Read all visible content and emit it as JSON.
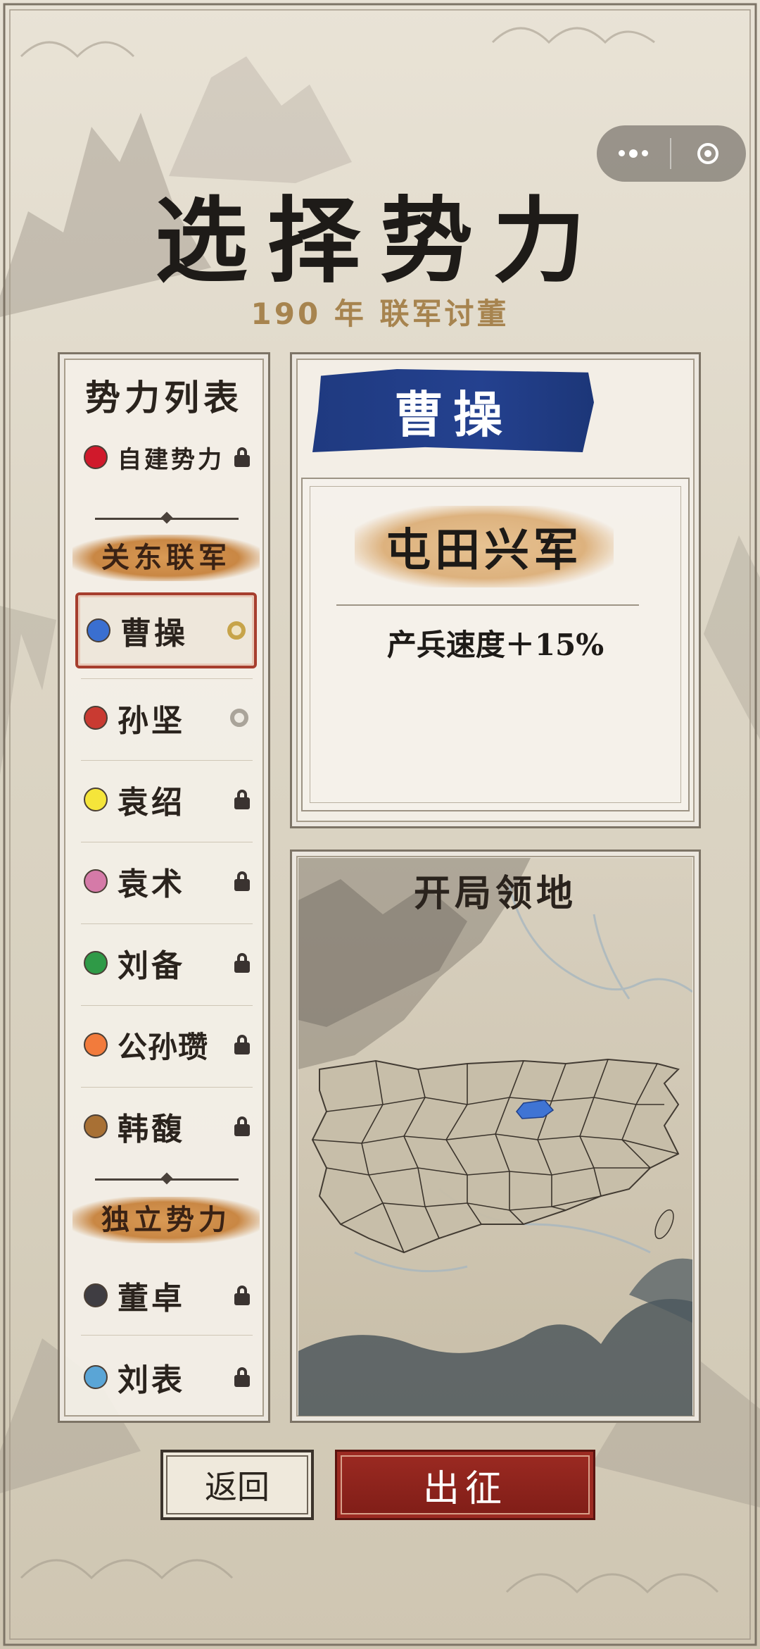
{
  "header": {
    "title": "选择势力",
    "subtitle": "190 年  联军讨董"
  },
  "sidebar": {
    "title": "势力列表",
    "custom": {
      "label": "自建势力",
      "color": "#d0192b",
      "status": "locked"
    },
    "groups": [
      {
        "label": "关东联军",
        "factions": [
          {
            "name": "曹操",
            "color": "#3a6fd0",
            "status": "selected"
          },
          {
            "name": "孙坚",
            "color": "#c93a31",
            "status": "available"
          },
          {
            "name": "袁绍",
            "color": "#f5e53a",
            "status": "locked"
          },
          {
            "name": "袁术",
            "color": "#d57aa8",
            "status": "locked"
          },
          {
            "name": "刘备",
            "color": "#2f9a47",
            "status": "locked"
          },
          {
            "name": "公孙瓒",
            "color": "#f27b3c",
            "status": "locked"
          },
          {
            "name": "韩馥",
            "color": "#a87034",
            "status": "locked"
          }
        ]
      },
      {
        "label": "独立势力",
        "factions": [
          {
            "name": "董卓",
            "color": "#3f3d42",
            "status": "locked"
          },
          {
            "name": "刘表",
            "color": "#5aa5d6",
            "status": "locked"
          }
        ]
      }
    ]
  },
  "detail": {
    "leader": "曹操",
    "leader_color": "#24418f",
    "trait_title": "屯田兴军",
    "trait_effect": "产兵速度＋15%"
  },
  "map": {
    "title": "开局领地",
    "highlight_color": "#3f74d4"
  },
  "actions": {
    "back_label": "返回",
    "go_label": "出征"
  },
  "capsule": {
    "menu_icon": "more-dots-icon",
    "close_icon": "target-ring-icon"
  }
}
